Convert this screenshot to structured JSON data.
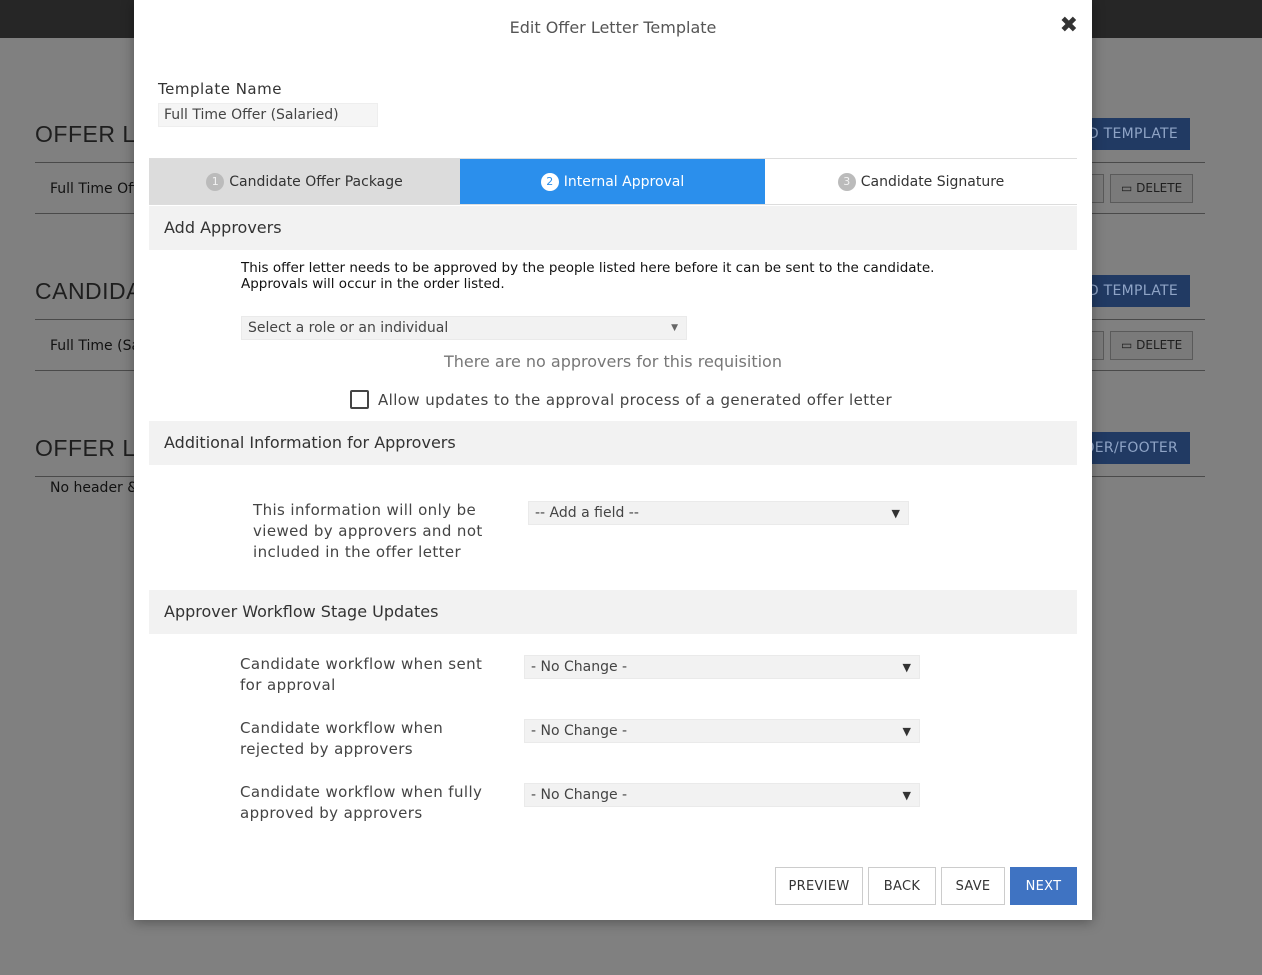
{
  "background": {
    "section1_title": "OFFER LE",
    "section1_button": "D TEMPLATE",
    "section1_row": "Full Time Offe",
    "section2_title": "CANDIDA",
    "section2_button": "D TEMPLATE",
    "section2_row": "Full Time (Sal",
    "section3_title": "OFFER LE",
    "section3_button": "DER/FOOTER",
    "section3_row": "No header &",
    "delete_label": "DELETE"
  },
  "modal": {
    "title": "Edit Offer Letter Template",
    "close_glyph": "✖",
    "template_name_label": "Template Name",
    "template_name_value": "Full Time Offer (Salaried)"
  },
  "tabs": [
    {
      "num": "1",
      "label": "Candidate Offer Package"
    },
    {
      "num": "2",
      "label": "Internal Approval"
    },
    {
      "num": "3",
      "label": "Candidate Signature"
    }
  ],
  "approvers": {
    "heading": "Add Approvers",
    "description": "This offer letter needs to be approved by the people listed here before it can be sent to the candidate. Approvals will occur in the order listed.",
    "select_placeholder": "Select a role or an individual",
    "empty_message": "There are no approvers for this requisition",
    "allow_updates_label": "Allow updates to the approval process of a generated offer letter"
  },
  "additional_info": {
    "heading": "Additional Information for Approvers",
    "text": "This information will only be viewed by approvers and not included in the offer letter",
    "add_field_value": "-- Add a field --"
  },
  "workflow": {
    "heading": "Approver Workflow Stage Updates",
    "rows": [
      {
        "label": "Candidate workflow when sent for approval",
        "value": "- No Change -"
      },
      {
        "label": "Candidate workflow when rejected by approvers",
        "value": "- No Change -"
      },
      {
        "label": "Candidate workflow when fully approved by approvers",
        "value": "- No Change -"
      }
    ]
  },
  "footer": {
    "preview": "PREVIEW",
    "back": "BACK",
    "save": "SAVE",
    "next": "NEXT"
  },
  "icons": {
    "caret": "▼",
    "trash": "🗑"
  }
}
